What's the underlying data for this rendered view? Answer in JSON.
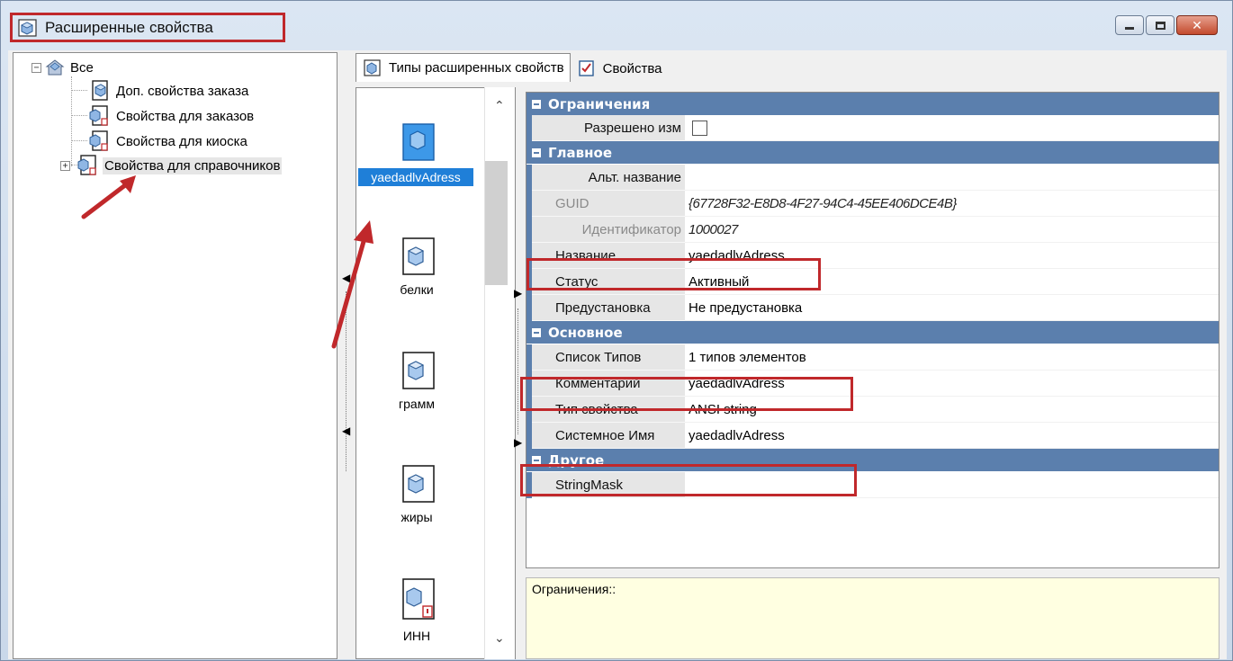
{
  "window": {
    "title": "Расширенные свойства",
    "close_label": "✕"
  },
  "tree": {
    "items": [
      {
        "label": "Все"
      },
      {
        "label": "Доп. свойства заказа"
      },
      {
        "label": "Свойства для заказов"
      },
      {
        "label": "Свойства для киоска"
      },
      {
        "label": "Свойства для справочников"
      }
    ]
  },
  "tabs": [
    {
      "label": "Типы расширенных свойств"
    },
    {
      "label": "Свойства"
    }
  ],
  "list": {
    "items": [
      {
        "label": "yaedadlvAdress"
      },
      {
        "label": "белки"
      },
      {
        "label": "грамм"
      },
      {
        "label": "жиры"
      },
      {
        "label": "ИНН"
      }
    ]
  },
  "grid": {
    "categories": {
      "restrictions": "Ограничения",
      "main": "Главное",
      "basic": "Основное",
      "other": "Другое"
    },
    "rows": {
      "allowed_edit": {
        "name": "Разрешено изм",
        "checked": false
      },
      "alt_name": {
        "name": "Альт. название",
        "value": ""
      },
      "guid": {
        "name": "GUID",
        "value": "{67728F32-E8D8-4F27-94C4-45EE406DCE4B}"
      },
      "identifier": {
        "name": "Идентификатор",
        "value": "1000027"
      },
      "name": {
        "name": "Название",
        "value": "yaedadlvAdress"
      },
      "status": {
        "name": "Статус",
        "value": "Активный"
      },
      "preset": {
        "name": "Предустановка",
        "value": "Не предустановка"
      },
      "type_list": {
        "name": "Список Типов",
        "value": "1 типов элементов"
      },
      "comment": {
        "name": "Комментарий",
        "value": "yaedadlvAdress"
      },
      "prop_type": {
        "name": "Тип свойства",
        "value": "ANSI string"
      },
      "system_name": {
        "name": "Системное Имя",
        "value": "yaedadlvAdress"
      },
      "string_mask": {
        "name": "StringMask",
        "value": ""
      }
    }
  },
  "description": {
    "text": "Ограничения::"
  },
  "colors": {
    "category_bg": "#5b7fad",
    "highlight": "#c0282b",
    "selection": "#1f7fd8",
    "description_bg": "#ffffe1"
  }
}
